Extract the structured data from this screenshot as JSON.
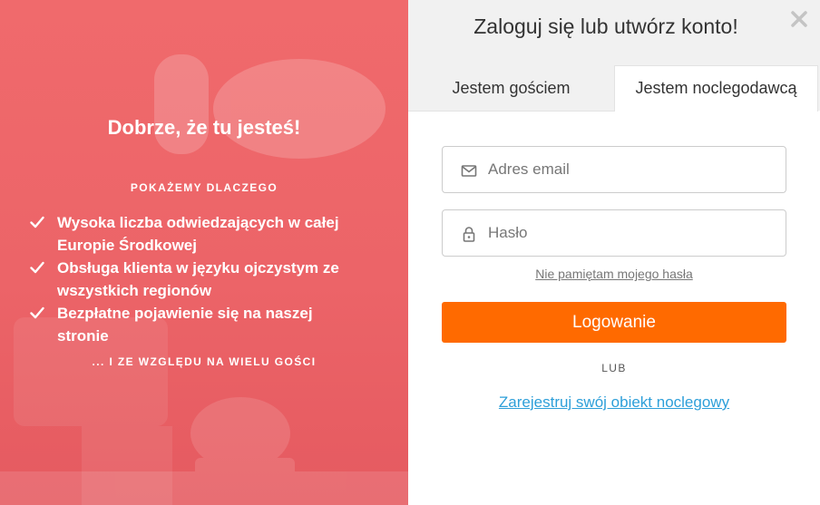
{
  "promo": {
    "title": "Dobrze, że tu jesteś!",
    "subtitle": "POKAŻEMY DLACZEGO",
    "benefits": [
      "Wysoka liczba odwiedzających w całej Europie Środkowej",
      "Obsługa klienta w języku ojczystym ze wszystkich regionów",
      "Bezpłatne pojawienie się na naszej stronie"
    ],
    "footer": "... I ZE WZGLĘDU NA WIELU GOŚCI",
    "check_icon": "checkmark-icon",
    "background_color": "#ec6468"
  },
  "login": {
    "title": "Zaloguj się lub utwórz konto!",
    "close_icon": "close-icon",
    "tabs": [
      {
        "label": "Jestem gościem",
        "active": false
      },
      {
        "label": "Jestem noclegodawcą",
        "active": true
      }
    ],
    "email": {
      "placeholder": "Adres email",
      "value": "",
      "icon": "envelope-icon"
    },
    "password": {
      "placeholder": "Hasło",
      "value": "",
      "icon": "lock-icon"
    },
    "forgot_label": "Nie pamiętam mojego hasła",
    "submit_label": "Logowanie",
    "or_label": "LUB",
    "register_label": "Zarejestruj swój obiekt noclegowy",
    "accent_color": "#ff6a00",
    "link_color": "#2d9fd9"
  }
}
